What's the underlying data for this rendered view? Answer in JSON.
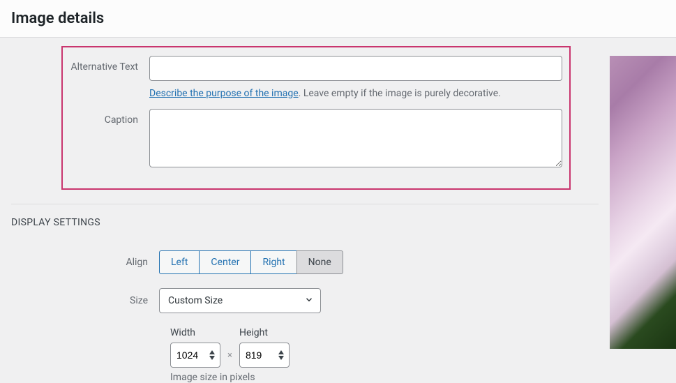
{
  "header": {
    "title": "Image details"
  },
  "fields": {
    "alt_label": "Alternative Text",
    "alt_value": "",
    "alt_help_link": "Describe the purpose of the image",
    "alt_help_rest": ". Leave empty if the image is purely decorative.",
    "caption_label": "Caption",
    "caption_value": ""
  },
  "display": {
    "section_title": "DISPLAY SETTINGS",
    "align_label": "Align",
    "align": {
      "left": "Left",
      "center": "Center",
      "right": "Right",
      "none": "None"
    },
    "size_label": "Size",
    "size_value": "Custom Size",
    "width_label": "Width",
    "width_value": "1024",
    "height_label": "Height",
    "height_value": "819",
    "mult": "×",
    "dim_help": "Image size in pixels"
  }
}
